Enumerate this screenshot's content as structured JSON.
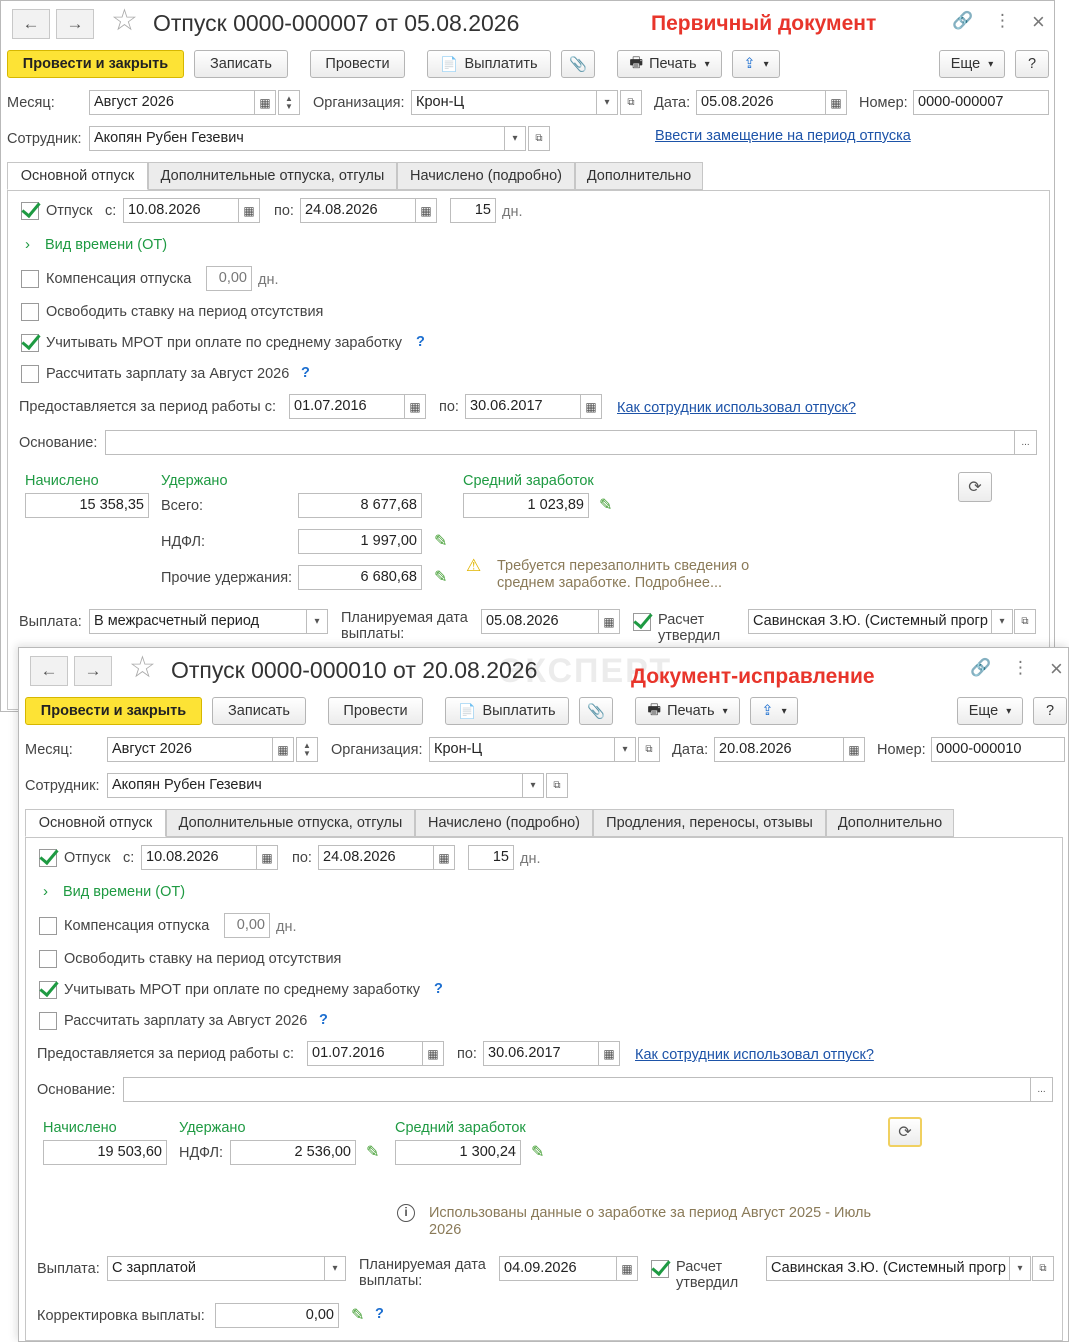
{
  "common": {
    "nav_back": "←",
    "nav_forward": "→",
    "star": "☆",
    "link_icon": "🔗",
    "more_icon": "⋮",
    "close_icon": "×",
    "btn_post_close": "Провести и закрыть",
    "btn_save": "Записать",
    "btn_post": "Провести",
    "btn_pay": "Выплатить",
    "btn_print": "Печать",
    "btn_more": "Еще",
    "btn_help": "?",
    "lbl_month": "Месяц:",
    "lbl_org": "Организация:",
    "lbl_date": "Дата:",
    "lbl_number": "Номер:",
    "lbl_employee": "Сотрудник:",
    "lbl_vacation": "Отпуск",
    "lbl_from": "с:",
    "lbl_to": "по:",
    "lbl_days": "дн.",
    "lbl_time_kind": "Вид времени (ОТ)",
    "lbl_compensation": "Компенсация отпуска",
    "lbl_release_rate": "Освободить ставку на период отсутствия",
    "lbl_mrot": "Учитывать МРОТ при оплате по среднему заработку",
    "lbl_calc_salary": "Рассчитать зарплату за Август 2026",
    "lbl_period_work": "Предоставляется за период работы с:",
    "lbl_basis": "Основание:",
    "lbl_accrued": "Начислено",
    "lbl_withheld": "Удержано",
    "lbl_avg_earnings": "Средний заработок",
    "lbl_payment": "Выплата:",
    "lbl_planned_date": "Планируемая дата выплаты:",
    "lbl_approved": "Расчет утвердил",
    "q": "?",
    "ellipsis": "..."
  },
  "doc1": {
    "title": "Отпуск 0000-000007 от 05.08.2026",
    "label": "Первичный документ",
    "month": "Август 2026",
    "org": "Крон-Ц",
    "date": "05.08.2026",
    "number": "0000-000007",
    "employee": "Акопян Рубен Гезевич",
    "substitution_link": "Ввести замещение на период отпуска",
    "tabs": [
      "Основной отпуск",
      "Дополнительные отпуска, отгулы",
      "Начислено (подробно)",
      "Дополнительно"
    ],
    "vac_from": "10.08.2026",
    "vac_to": "24.08.2026",
    "vac_days": "15",
    "compensation_days": "0,00",
    "period_from": "01.07.2016",
    "period_to": "30.06.2017",
    "how_used_link": "Как сотрудник использовал отпуск?",
    "basis": "",
    "accrued": "15 358,35",
    "lbl_total": "Всего:",
    "withheld_total": "8 677,68",
    "lbl_ndfl": "НДФЛ:",
    "ndfl": "1 997,00",
    "lbl_other": "Прочие удержания:",
    "other": "6 680,68",
    "avg_earnings": "1 023,89",
    "warning": "Требуется перезаполнить сведения о среднем заработке. Подробнее...",
    "payment": "В межрасчетный период",
    "planned_date": "05.08.2026",
    "approver": "Савинская З.Ю. (Системный прогр"
  },
  "doc2": {
    "title": "Отпуск 0000-000010 от 20.08.2026",
    "label": "Документ-исправление",
    "watermark": "ЭКСПЕРТ",
    "month": "Август 2026",
    "org": "Крон-Ц",
    "date": "20.08.2026",
    "number": "0000-000010",
    "employee": "Акопян Рубен Гезевич",
    "tabs": [
      "Основной отпуск",
      "Дополнительные отпуска, отгулы",
      "Начислено (подробно)",
      "Продления, переносы, отзывы",
      "Дополнительно"
    ],
    "vac_from": "10.08.2026",
    "vac_to": "24.08.2026",
    "vac_days": "15",
    "compensation_days": "0,00",
    "period_from": "01.07.2016",
    "period_to": "30.06.2017",
    "how_used_link": "Как сотрудник использовал отпуск?",
    "basis": "",
    "accrued": "19 503,60",
    "lbl_ndfl": "НДФЛ:",
    "ndfl": "2 536,00",
    "avg_earnings": "1 300,24",
    "info": "Использованы данные о заработке за период Август 2025 - Июль 2026",
    "payment": "С зарплатой",
    "planned_date": "04.09.2026",
    "approver": "Савинская З.Ю. (Системный прогр",
    "lbl_correction": "Корректировка выплаты:",
    "correction": "0,00"
  }
}
